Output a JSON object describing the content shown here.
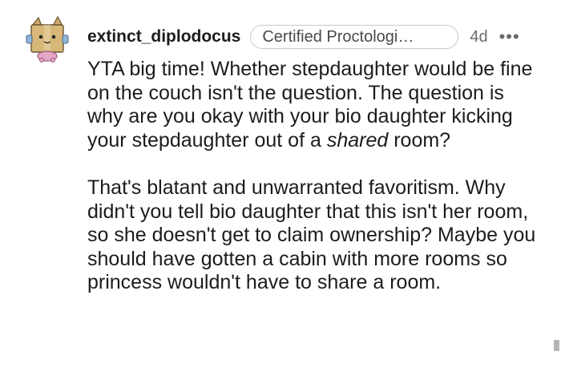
{
  "comment": {
    "author": "extinct_diplodocus",
    "flair": "Certified Proctologi…",
    "age": "4d",
    "more_label": "•••",
    "paragraph1": {
      "before": "YTA big time! Whether stepdaughter would be fine on the couch isn't the question. The question is why are you okay with your bio daughter kicking your stepdaughter out of a ",
      "emphasis": "shared",
      "after": " room?"
    },
    "paragraph2": "That's blatant and unwarranted favoritism. Why didn't you tell bio daughter that this isn't her room, so she doesn't get to claim ownership? Maybe you should have gotten a cabin with more rooms so princess wouldn't have to share a room."
  }
}
